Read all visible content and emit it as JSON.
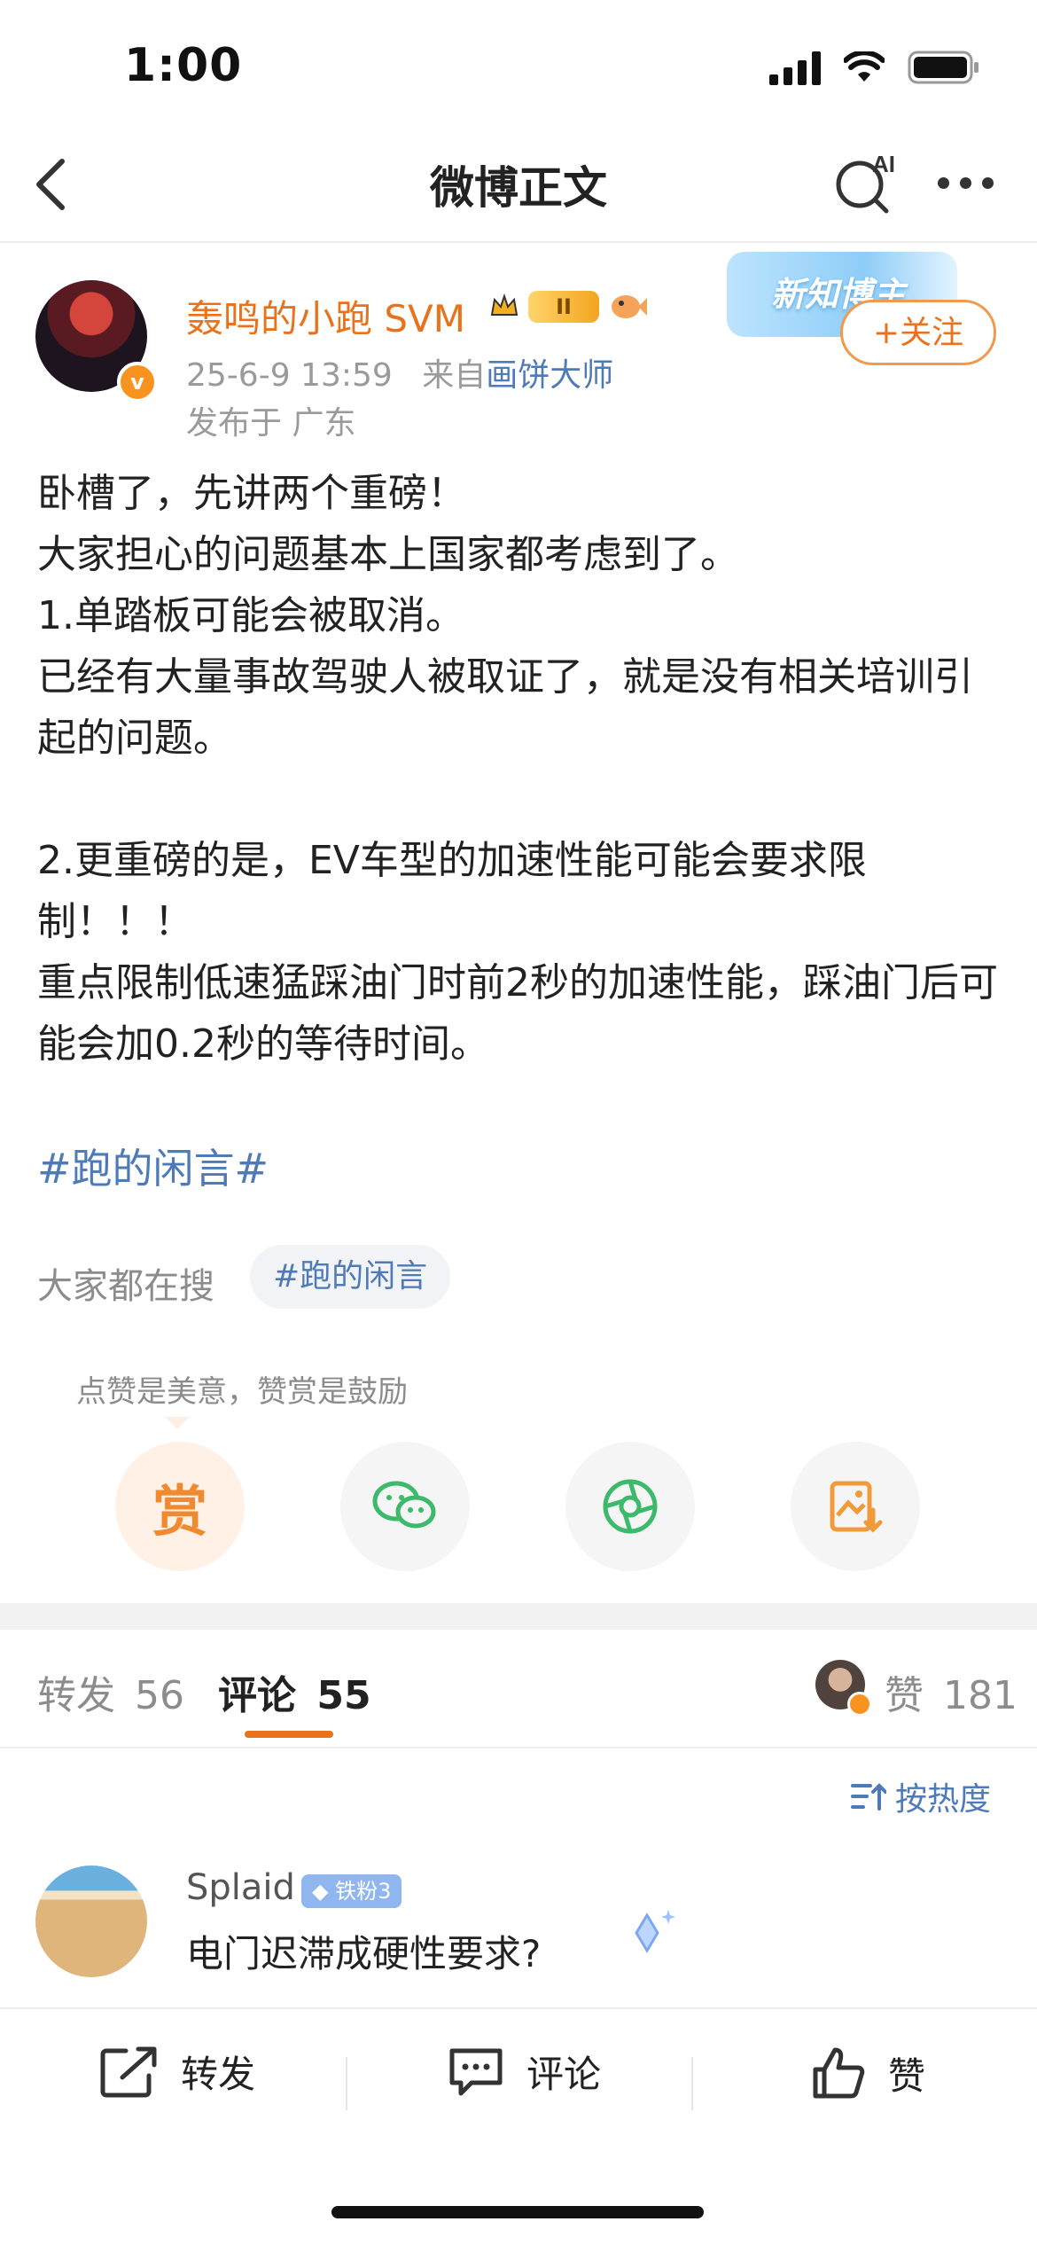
{
  "status_bar": {
    "time": "1:00"
  },
  "nav": {
    "title": "微博正文",
    "ai_label": "AI"
  },
  "author": {
    "name": "轰鸣的小跑 SVM",
    "level_badge": "II",
    "post_time": "25-6-9 13:59",
    "source_prefix": "来自",
    "source": "画饼大师",
    "location": "发布于 广东",
    "banner_text": "新知博主",
    "follow_label": "+关注"
  },
  "post": {
    "paragraphs": [
      "卧槽了，先讲两个重磅！",
      "大家担心的问题基本上国家都考虑到了。",
      "1.单踏板可能会被取消。",
      "已经有大量事故驾驶人被取证了，就是没有相关培训引起的问题。",
      "",
      "2.更重磅的是，EV车型的加速性能可能会要求限制！！！",
      "重点限制低速猛踩油门时前2秒的加速性能，踩油门后可能会加0.2秒的等待时间。"
    ],
    "hashtag": "#跑的闲言#"
  },
  "search": {
    "label": "大家都在搜",
    "chip": "#跑的闲言"
  },
  "reward": {
    "tip": "点赞是美意，赞赏是鼓励",
    "reward_label": "赏"
  },
  "tabs": {
    "repost_label": "转发",
    "repost_count": "56",
    "comment_label": "评论",
    "comment_count": "55",
    "like_label": "赞",
    "like_count": "181"
  },
  "sort": {
    "label": "按热度"
  },
  "comments": [
    {
      "user": "Splaid",
      "badge": "铁粉3",
      "text": "电门迟滞成硬性要求?"
    }
  ],
  "actions": {
    "repost": "转发",
    "comment": "评论",
    "like": "赞"
  },
  "colors": {
    "accent": "#e8731c",
    "link": "#4e7ab8",
    "muted": "#8c8c8c"
  }
}
